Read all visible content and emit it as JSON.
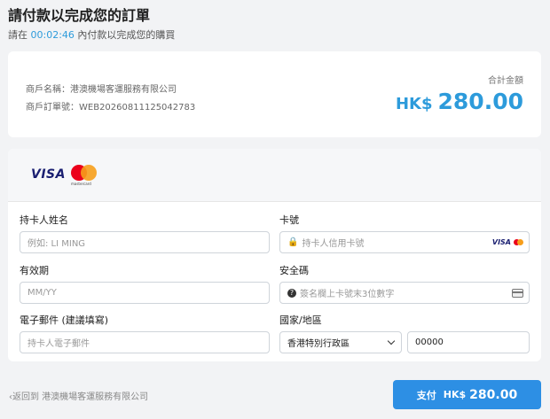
{
  "header": {
    "title": "請付款以完成您的訂單",
    "timer_prefix": "請在",
    "timer_value": "00:02:46",
    "timer_suffix": "內付款以完成您的購買"
  },
  "summary": {
    "merchant_name_label": "商戶名稱：",
    "merchant_name": "港澳機場客運服務有限公司",
    "order_no_label": "商戶訂單號：",
    "order_no": "WEB20260811125042783",
    "total_label": "合計金額",
    "currency": "HK$",
    "amount": "280.00"
  },
  "brands": {
    "visa": "VISA",
    "mastercard": "mastercard"
  },
  "form": {
    "cardholder_label": "持卡人姓名",
    "cardholder_placeholder": "例如: LI MING",
    "card_number_label": "卡號",
    "card_number_placeholder": "持卡人信用卡號",
    "expiry_label": "有效期",
    "expiry_placeholder": "MM/YY",
    "cvv_label": "安全碼",
    "cvv_placeholder": "簽名欄上卡號末3位數字",
    "email_label": "電子郵件 (建議填寫)",
    "email_placeholder": "持卡人電子郵件",
    "country_label": "國家/地區",
    "country_value": "香港特別行政區",
    "postal_value": "00000"
  },
  "footer": {
    "back_label": "返回到 港澳機場客運服務有限公司",
    "pay_label": "支付",
    "pay_currency": "HK$",
    "pay_amount": "280.00"
  },
  "colors": {
    "accent": "#2d9bdb",
    "button": "#2d8fe4"
  }
}
